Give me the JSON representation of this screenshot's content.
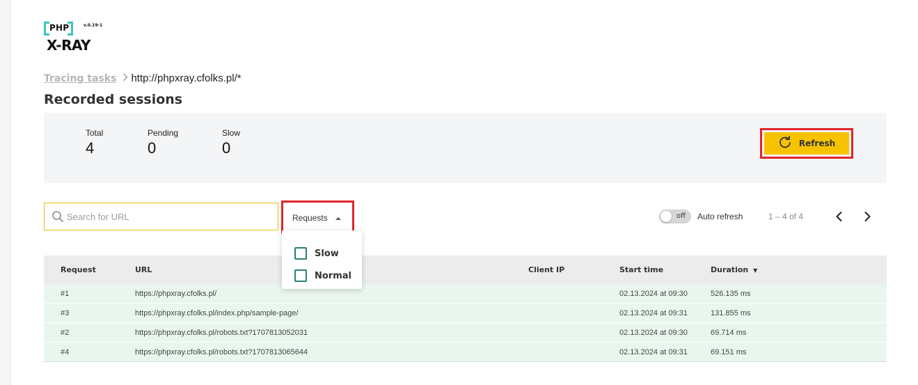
{
  "logo": {
    "php": "PHP",
    "version": "v.0.19-1",
    "name": "X-RAY"
  },
  "breadcrumb": {
    "parent": "Tracing tasks",
    "current": "http://phpxray.cfolks.pl/*"
  },
  "page_title": "Recorded sessions",
  "stats": {
    "total_label": "Total",
    "total_value": "4",
    "pending_label": "Pending",
    "pending_value": "0",
    "slow_label": "Slow",
    "slow_value": "0"
  },
  "refresh_label": "Refresh",
  "search": {
    "placeholder": "Search for URL",
    "value": ""
  },
  "filter": {
    "label": "Requests",
    "options": [
      {
        "label": "Slow",
        "checked": false
      },
      {
        "label": "Normal",
        "checked": false
      }
    ]
  },
  "auto_refresh": {
    "toggle_text": "off",
    "label": "Auto refresh"
  },
  "pagination": {
    "info": "1 – 4 of 4"
  },
  "table": {
    "headers": {
      "request": "Request",
      "url": "URL",
      "client_ip": "Client IP",
      "start_time": "Start time",
      "duration": "Duration"
    },
    "sort_indicator": "▼",
    "rows": [
      {
        "request": "#1",
        "url": "https://phpxray.cfolks.pl/",
        "client_ip": "",
        "start_time": "02.13.2024 at 09:30",
        "duration": "526.135 ms"
      },
      {
        "request": "#3",
        "url": "https://phpxray.cfolks.pl/index.php/sample-page/",
        "client_ip": "",
        "start_time": "02.13.2024 at 09:31",
        "duration": "131.855 ms"
      },
      {
        "request": "#2",
        "url": "https://phpxray.cfolks.pl/robots.txt?1707813052031",
        "client_ip": "",
        "start_time": "02.13.2024 at 09:30",
        "duration": "69.714 ms"
      },
      {
        "request": "#4",
        "url": "https://phpxray.cfolks.pl/robots.txt?1707813065644",
        "client_ip": "",
        "start_time": "02.13.2024 at 09:31",
        "duration": "69.151 ms"
      }
    ]
  },
  "colors": {
    "accent_yellow": "#f7c300",
    "highlight_red": "#e0252b",
    "logo_teal": "#3fc4c0",
    "row_green": "#e9f6ee",
    "checkbox_teal": "#2b7f76"
  },
  "icons": {
    "refresh": "refresh-icon",
    "search": "search-icon",
    "filter_toggle": "caret-up-icon",
    "prev": "chevron-left-icon",
    "next": "chevron-right-icon"
  }
}
